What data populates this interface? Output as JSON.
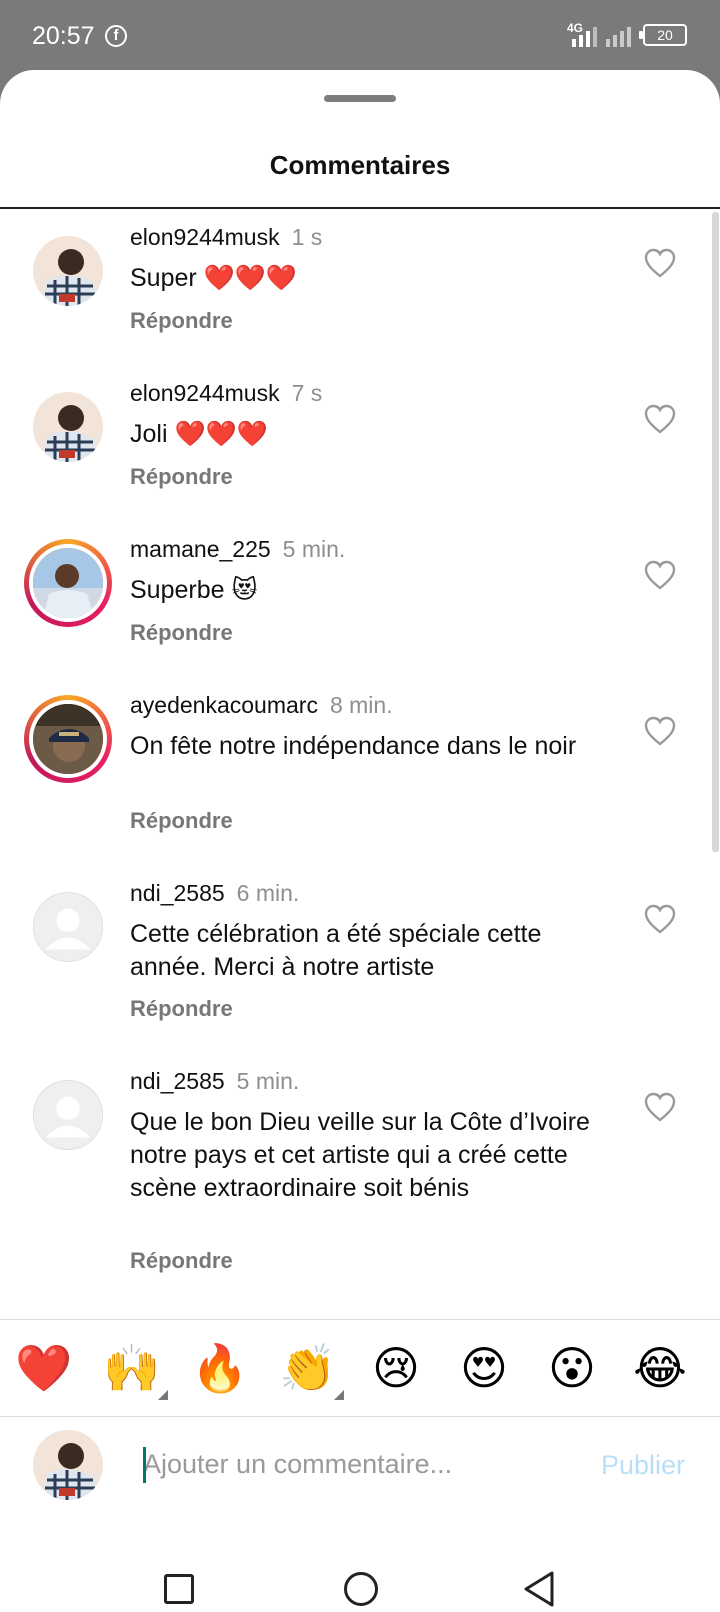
{
  "status_bar": {
    "time": "20:57",
    "network": "4G",
    "battery": "20"
  },
  "sheet": {
    "title": "Commentaires"
  },
  "comments": [
    {
      "username": "elon9244musk",
      "time": "1 s",
      "text": "Super ❤️❤️❤️",
      "reply": "Répondre"
    },
    {
      "username": "elon9244musk",
      "time": "7 s",
      "text": "Joli ❤️❤️❤️",
      "reply": "Répondre"
    },
    {
      "username": "mamane_225",
      "time": "5 min.",
      "text": "Superbe 😻",
      "reply": "Répondre"
    },
    {
      "username": "ayedenkacoumarc",
      "time": "8 min.",
      "text": "On fête notre indépendance dans le noir",
      "reply": "Répondre"
    },
    {
      "username": "ndi_2585",
      "time": "6 min.",
      "text": "Cette célébration a été spéciale cette année. Merci à notre artiste",
      "reply": "Répondre"
    },
    {
      "username": "ndi_2585",
      "time": "5 min.",
      "text": "Que le bon Dieu veille sur la Côte d’Ivoire notre pays et cet artiste qui a créé cette scène extraordinaire soit bénis",
      "reply": "Répondre"
    }
  ],
  "emoji_bar": [
    "❤️",
    "🙌",
    "🔥",
    "👏",
    "😢",
    "😍",
    "😮",
    "😂"
  ],
  "composer": {
    "placeholder": "Ajouter un commentaire...",
    "publish": "Publier"
  },
  "colors": {
    "accent_disabled": "#b9dff8",
    "story_ring": "#e91e63"
  }
}
